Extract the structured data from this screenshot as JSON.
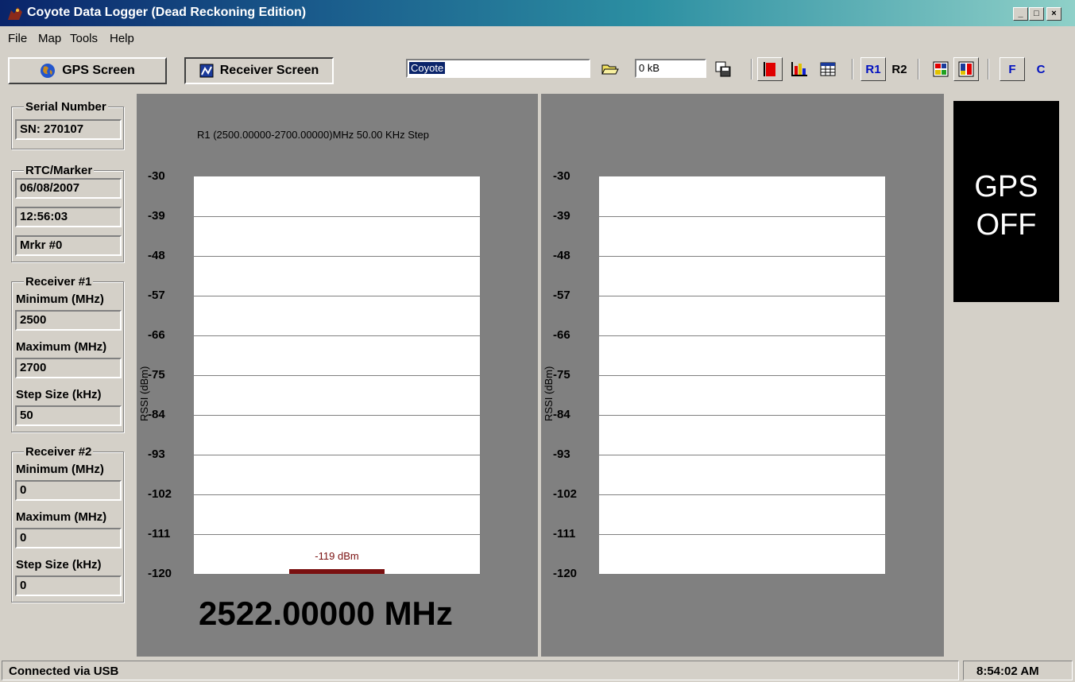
{
  "window": {
    "title": "Coyote Data Logger (Dead Reckoning Edition)",
    "min": "_",
    "max": "□",
    "close": "×"
  },
  "menu": [
    "File",
    "Map",
    "Tools",
    "Help"
  ],
  "toolbar": {
    "gps_screen": "GPS Screen",
    "receiver_screen": "Receiver Screen",
    "name_value": "Coyote",
    "size_value": "0 kB",
    "r1": "R1",
    "r2": "R2",
    "f": "F",
    "c": "C"
  },
  "sidebar": {
    "serial_title": "Serial Number",
    "serial": "SN: 270107",
    "rtc_title": "RTC/Marker",
    "date": "06/08/2007",
    "time": "12:56:03",
    "marker": "Mrkr #0",
    "rx1_title": "Receiver #1",
    "rx1_min_label": "Minimum (MHz)",
    "rx1_min": "2500",
    "rx1_max_label": "Maximum (MHz)",
    "rx1_max": "2700",
    "rx1_step_label": "Step Size (kHz)",
    "rx1_step": "50",
    "rx2_title": "Receiver #2",
    "rx2_min_label": "Minimum (MHz)",
    "rx2_min": "0",
    "rx2_max_label": "Maximum (MHz)",
    "rx2_max": "0",
    "rx2_step_label": "Step Size (kHz)",
    "rx2_step": "0"
  },
  "panel1": {
    "header": "R1 (2500.00000-2700.00000)MHz 50.00 KHz Step",
    "ylabel": "RSSI (dBm)",
    "frequency": "2522.00000 MHz",
    "marker_label": "-119 dBm"
  },
  "panel2": {
    "ylabel": "RSSI (dBm)"
  },
  "gps": {
    "line1": "GPS",
    "line2": "OFF"
  },
  "status": {
    "left": "Connected via USB",
    "right": "8:54:02 AM"
  },
  "chart_data": [
    {
      "type": "bar",
      "title": "R1 (2500.00000-2700.00000)MHz 50.00 KHz Step",
      "ylabel": "RSSI (dBm)",
      "ylim": [
        -120,
        -30
      ],
      "yticks": [
        "-30",
        "-39",
        "-48",
        "-57",
        "-66",
        "-75",
        "-84",
        "-93",
        "-102",
        "-111",
        "-120"
      ],
      "values": [
        -119
      ],
      "data_label": "-119 dBm",
      "bar_color": "#7a1010",
      "grid": true
    },
    {
      "type": "bar",
      "ylabel": "RSSI (dBm)",
      "ylim": [
        -120,
        -30
      ],
      "yticks": [
        "-30",
        "-39",
        "-48",
        "-57",
        "-66",
        "-75",
        "-84",
        "-93",
        "-102",
        "-111",
        "-120"
      ],
      "values": [],
      "grid": true
    }
  ]
}
